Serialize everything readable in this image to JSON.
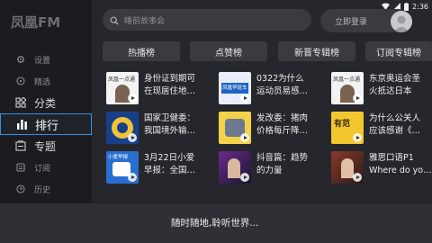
{
  "status_bar": {
    "time": "2:36"
  },
  "app": {
    "logo": "凤凰FM"
  },
  "sidebar": {
    "items": [
      {
        "label": "设置",
        "icon": "gear-icon"
      },
      {
        "label": "精选",
        "icon": "compass-icon"
      },
      {
        "label": "分类",
        "icon": "grid-icon"
      },
      {
        "label": "排行",
        "icon": "bar-chart-icon"
      },
      {
        "label": "专题",
        "icon": "album-icon"
      },
      {
        "label": "订阅",
        "icon": "subscribe-icon"
      },
      {
        "label": "历史",
        "icon": "clock-icon"
      }
    ]
  },
  "header": {
    "search_placeholder": "睡前故事会",
    "login_label": "立即登录"
  },
  "tabs": [
    "热播榜",
    "点赞榜",
    "新晋专辑榜",
    "订阅专辑榜"
  ],
  "cards": [
    {
      "title": "身份证到期可\n在现居住地…",
      "thumb_text": "凤凰一点通"
    },
    {
      "title": "0322为什么\n运动员易感…",
      "thumb_text": "凤凰早班车"
    },
    {
      "title": "东京奥运会圣\n火抵达日本",
      "thumb_text": "凤凰一点通"
    },
    {
      "title": "国家卫健委：\n我国境外输…",
      "thumb_text": ""
    },
    {
      "title": "发改委：猪肉\n价格每斤降…",
      "thumb_text": ""
    },
    {
      "title": "为什么公关人\n应该感谢《…",
      "thumb_text": "有范"
    },
    {
      "title": "3月22日小爱\n早报：全国…",
      "thumb_text": "小爱早报"
    },
    {
      "title": "抖音篇：趋势\n的力量",
      "thumb_text": ""
    },
    {
      "title": "雅思口语P1\nWhere do yo…",
      "thumb_text": ""
    }
  ],
  "bottom_bar": {
    "text": "随时随地,聆听世界..."
  },
  "colors": {
    "accent": "#3a8fe0",
    "background": "#26272c",
    "sidebar": "#1c1c20"
  }
}
